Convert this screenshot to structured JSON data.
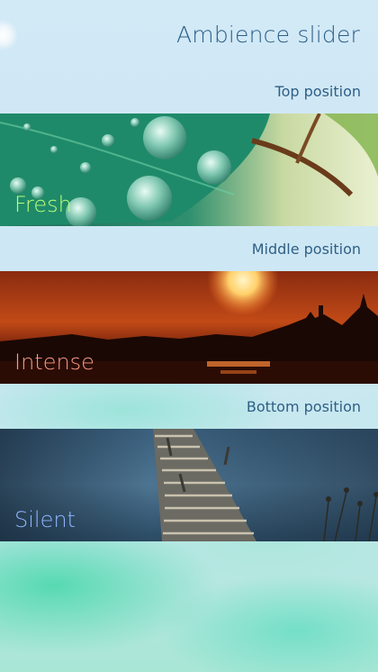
{
  "page": {
    "title": "Ambience slider"
  },
  "sections": [
    {
      "header": "Top position",
      "label": "Fresh",
      "label_color": "#b8ff7a"
    },
    {
      "header": "Middle position",
      "label": "Intense",
      "label_color": "#ff9a84"
    },
    {
      "header": "Bottom position",
      "label": "Silent",
      "label_color": "#8fb6ff"
    }
  ],
  "colors": {
    "header_text": "#2f5f85",
    "background": "#cfe6f2"
  }
}
